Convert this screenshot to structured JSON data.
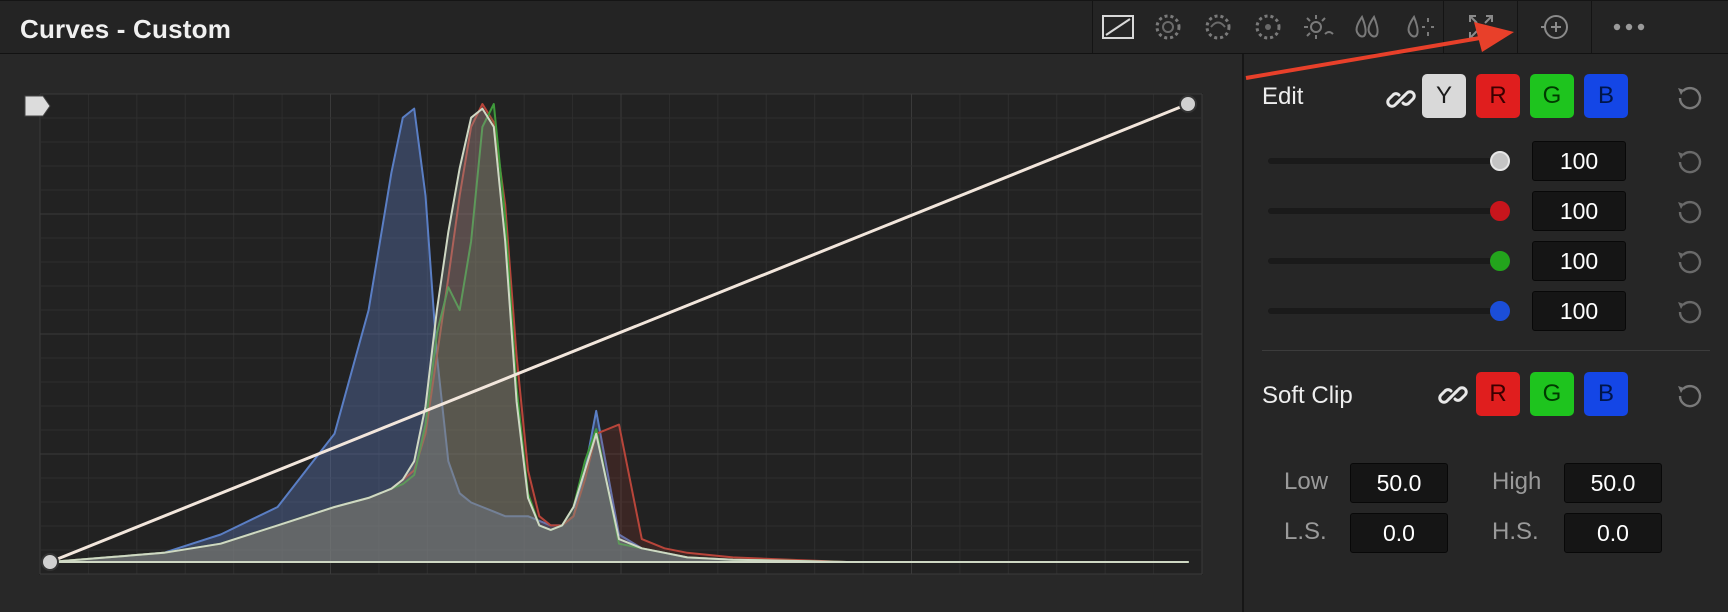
{
  "header": {
    "title": "Curves - Custom",
    "toolbar_icons": [
      "custom-curve-icon",
      "hue-vs-hue-icon",
      "hue-vs-sat-icon",
      "hue-vs-lum-icon",
      "lum-vs-sat-icon",
      "sat-vs-sat-icon",
      "sat-vs-lum-icon",
      "expand-icon",
      "add-node-icon",
      "more-options-icon"
    ]
  },
  "edit": {
    "label": "Edit",
    "channels": [
      "Y",
      "R",
      "G",
      "B"
    ],
    "sliders": [
      {
        "channel": "Y",
        "value": "100",
        "color": "#c4c4c4",
        "level": 1.0
      },
      {
        "channel": "R",
        "value": "100",
        "color": "#c8151c",
        "level": 1.0
      },
      {
        "channel": "G",
        "value": "100",
        "color": "#23a41c",
        "level": 1.0
      },
      {
        "channel": "B",
        "value": "100",
        "color": "#1b4ed8",
        "level": 1.0
      }
    ]
  },
  "soft_clip": {
    "label": "Soft Clip",
    "channels": [
      "R",
      "G",
      "B"
    ],
    "low_label": "Low",
    "low_value": "50.0",
    "high_label": "High",
    "high_value": "50.0",
    "ls_label": "L.S.",
    "ls_value": "0.0",
    "hs_label": "H.S.",
    "hs_value": "0.0"
  },
  "colors": {
    "y_button": "#d9d9d9",
    "r_button": "#e01e1e",
    "g_button": "#1ec41e",
    "b_button": "#1446e6",
    "annotation_arrow": "#e8402a",
    "curve": "#f2e6dc"
  },
  "chart_data": {
    "type": "area",
    "x": [
      0,
      0.05,
      0.1,
      0.15,
      0.2,
      0.25,
      0.28,
      0.3,
      0.31,
      0.32,
      0.33,
      0.34,
      0.35,
      0.36,
      0.37,
      0.38,
      0.39,
      0.4,
      0.41,
      0.42,
      0.43,
      0.44,
      0.45,
      0.46,
      0.47,
      0.48,
      0.5,
      0.52,
      0.54,
      0.56,
      0.6,
      0.7,
      1.0
    ],
    "series": [
      {
        "color": "blue",
        "values": [
          0,
          0.01,
          0.02,
          0.06,
          0.12,
          0.28,
          0.55,
          0.85,
          0.97,
          0.99,
          0.8,
          0.45,
          0.22,
          0.15,
          0.13,
          0.12,
          0.11,
          0.1,
          0.1,
          0.1,
          0.09,
          0.08,
          0.08,
          0.1,
          0.2,
          0.33,
          0.06,
          0.03,
          0.02,
          0.01,
          0.005,
          0,
          0
        ]
      },
      {
        "color": "red",
        "values": [
          0,
          0.01,
          0.02,
          0.04,
          0.08,
          0.12,
          0.14,
          0.16,
          0.18,
          0.2,
          0.28,
          0.45,
          0.62,
          0.8,
          0.95,
          1.0,
          0.96,
          0.78,
          0.45,
          0.2,
          0.1,
          0.08,
          0.08,
          0.1,
          0.18,
          0.28,
          0.3,
          0.05,
          0.03,
          0.02,
          0.01,
          0,
          0
        ]
      },
      {
        "color": "green",
        "values": [
          0,
          0.01,
          0.02,
          0.04,
          0.08,
          0.12,
          0.14,
          0.16,
          0.17,
          0.19,
          0.3,
          0.5,
          0.6,
          0.55,
          0.7,
          0.95,
          1.0,
          0.75,
          0.38,
          0.15,
          0.08,
          0.07,
          0.08,
          0.12,
          0.22,
          0.29,
          0.04,
          0.03,
          0.02,
          0.01,
          0.005,
          0,
          0
        ]
      },
      {
        "color": "luma",
        "values": [
          0,
          0.01,
          0.02,
          0.04,
          0.08,
          0.12,
          0.14,
          0.16,
          0.18,
          0.22,
          0.34,
          0.55,
          0.72,
          0.86,
          0.97,
          0.99,
          0.95,
          0.7,
          0.35,
          0.14,
          0.08,
          0.07,
          0.08,
          0.12,
          0.2,
          0.28,
          0.05,
          0.03,
          0.02,
          0.01,
          0.005,
          0,
          0
        ]
      }
    ],
    "curve_points": [
      [
        0,
        0
      ],
      [
        1,
        1
      ]
    ],
    "xlim": [
      0,
      1
    ],
    "ylim": [
      0,
      1
    ],
    "grid": true
  }
}
